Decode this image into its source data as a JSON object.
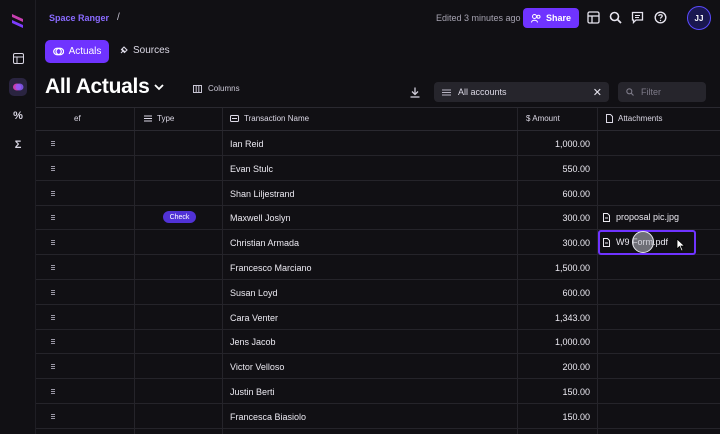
{
  "workspace": "Space Ranger",
  "breadcrumb_sep": "/",
  "edited": "Edited 3 minutes ago",
  "share_label": "Share",
  "avatar": "JJ",
  "tabs": {
    "actuals": "Actuals",
    "sources": "Sources"
  },
  "page_title": "All Actuals",
  "columns_label": "Columns",
  "account_filter": "All accounts",
  "filter_placeholder": "Filter",
  "headers": {
    "ref": "ef",
    "type": "Type",
    "transaction": "Transaction Name",
    "amount": "$ Amount",
    "attachments": "Attachments"
  },
  "rows": [
    {
      "name": "Ian Reid",
      "amount": "1,000.00",
      "type": "",
      "attachment": ""
    },
    {
      "name": "Evan Stulc",
      "amount": "550.00",
      "type": "",
      "attachment": ""
    },
    {
      "name": "Shan Liljestrand",
      "amount": "600.00",
      "type": "",
      "attachment": ""
    },
    {
      "name": "Maxwell Joslyn",
      "amount": "300.00",
      "type": "Check",
      "attachment": "proposal pic.jpg"
    },
    {
      "name": "Christian Armada",
      "amount": "300.00",
      "type": "",
      "attachment": "W9 Form.pdf"
    },
    {
      "name": "Francesco Marciano",
      "amount": "1,500.00",
      "type": "",
      "attachment": ""
    },
    {
      "name": "Susan Loyd",
      "amount": "600.00",
      "type": "",
      "attachment": ""
    },
    {
      "name": "Cara Venter",
      "amount": "1,343.00",
      "type": "",
      "attachment": ""
    },
    {
      "name": "Jens Jacob",
      "amount": "1,000.00",
      "type": "",
      "attachment": ""
    },
    {
      "name": "Victor Velloso",
      "amount": "200.00",
      "type": "",
      "attachment": ""
    },
    {
      "name": "Justin Berti",
      "amount": "150.00",
      "type": "",
      "attachment": ""
    },
    {
      "name": "Francesca Biasiolo",
      "amount": "150.00",
      "type": "",
      "attachment": ""
    }
  ],
  "selected_attachment_row": 4,
  "colors": {
    "accent": "#6f33ff",
    "background": "#111014",
    "badge": "#5132d6"
  }
}
